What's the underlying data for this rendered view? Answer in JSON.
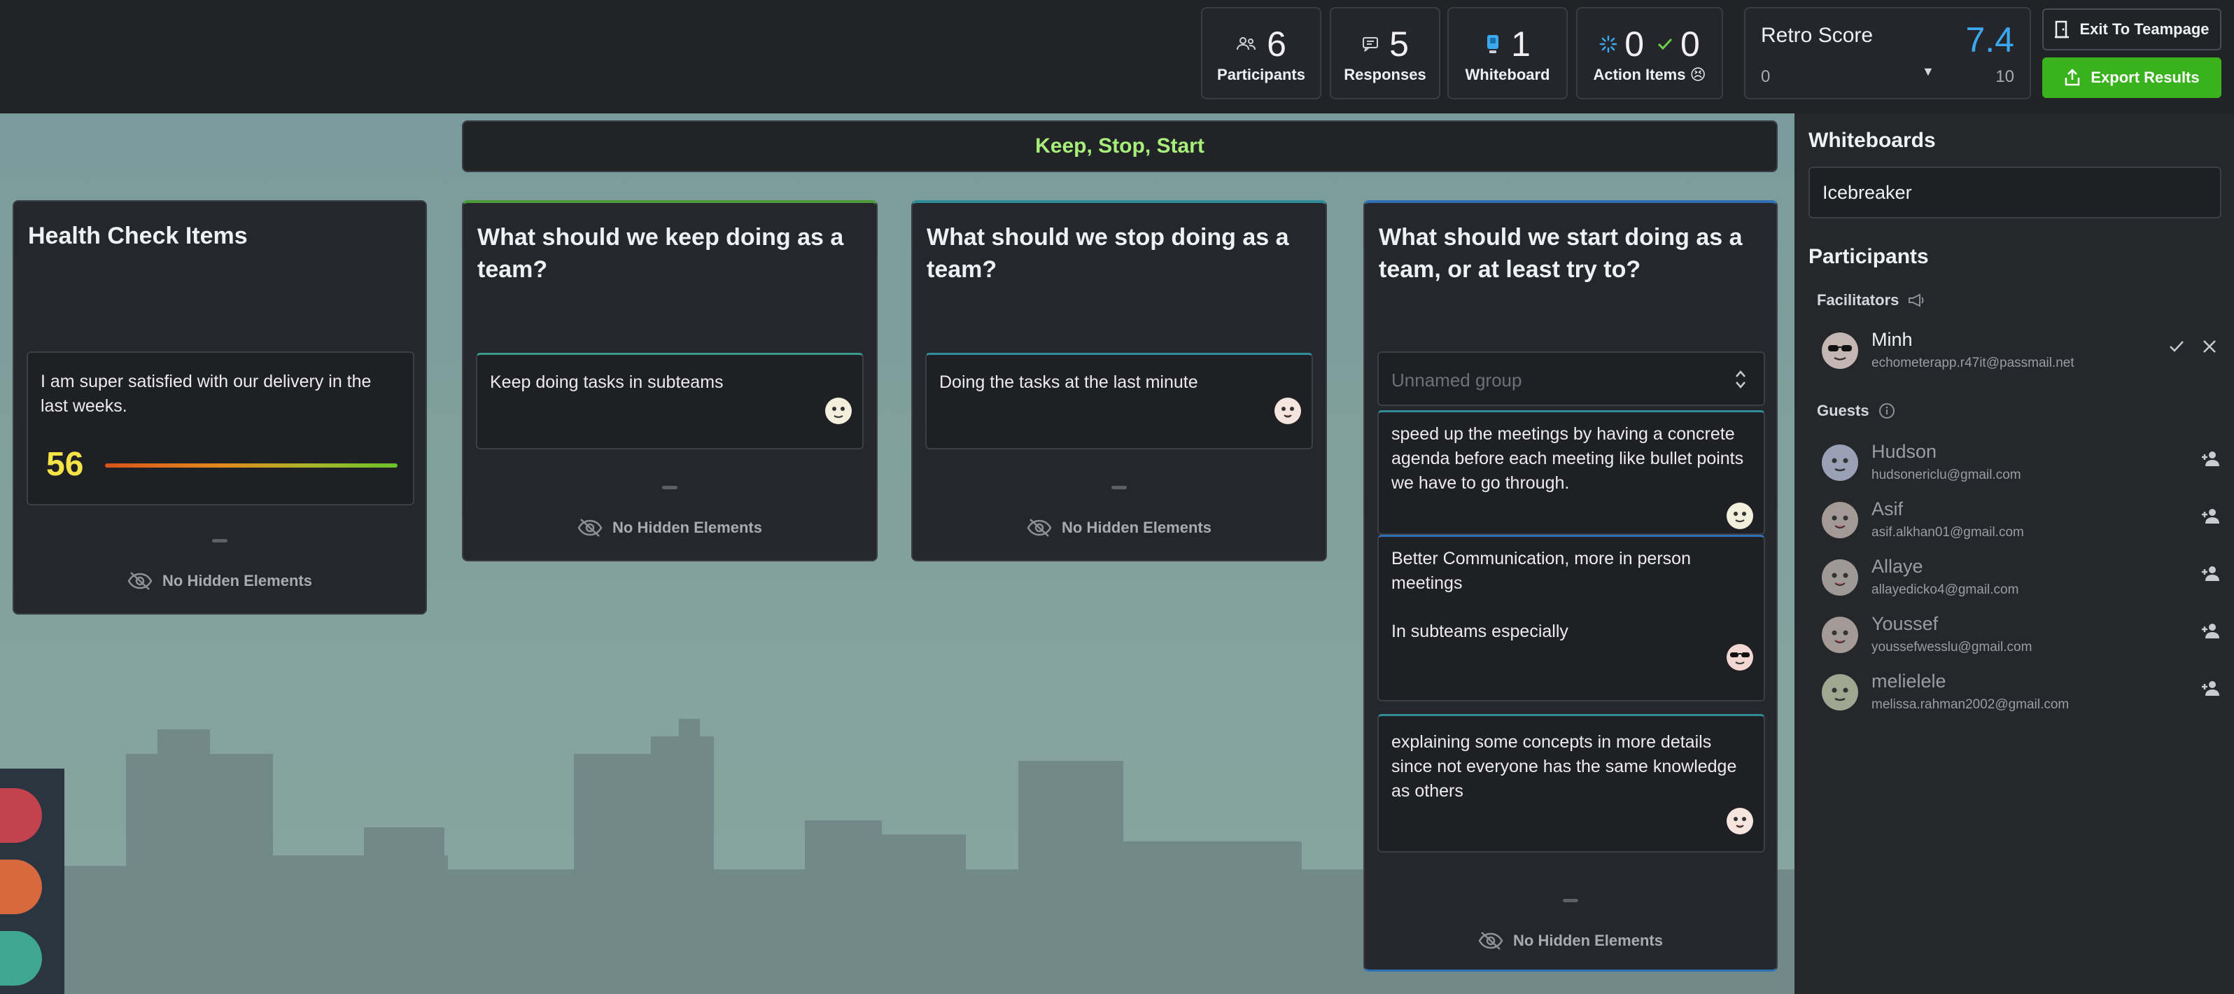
{
  "topbar": {
    "stats": [
      {
        "value": "6",
        "label": "Participants",
        "icon": "participants-icon"
      },
      {
        "value": "5",
        "label": "Responses",
        "icon": "responses-icon"
      },
      {
        "value": "1",
        "label": "Whiteboard",
        "icon": "whiteboard-icon"
      }
    ],
    "action_items": {
      "pending": "0",
      "done": "0",
      "label": "Action Items",
      "emoji": "😣"
    },
    "retro_score": {
      "title": "Retro Score",
      "value": "7.4",
      "min": "0",
      "max": "10"
    },
    "exit_label": "Exit To Teampage",
    "export_label": "Export Results"
  },
  "board": {
    "title": "Keep, Stop, Start"
  },
  "columns": {
    "health": {
      "title": "Health Check Items",
      "card_text": "I am super satisfied with our delivery in the last weeks.",
      "score": "56",
      "hidden_label": "No Hidden Elements"
    },
    "keep": {
      "title": "What should we keep doing as a team?",
      "card_text": "Keep doing tasks in subteams",
      "hidden_label": "No Hidden Elements"
    },
    "stop": {
      "title": "What should we stop doing as a team?",
      "card_text": "Doing the tasks at the last minute",
      "hidden_label": "No Hidden Elements"
    },
    "start": {
      "title": "What should we start doing as a team, or at least try to?",
      "group_placeholder": "Unnamed group",
      "cards": [
        "speed up the meetings by having a concrete agenda before each meeting like bullet points we have to go through.",
        "Better Communication, more in person meetings",
        "In subteams especially",
        "explaining some concepts in more details since not everyone has the same knowledge as others"
      ],
      "hidden_label": "No Hidden Elements"
    }
  },
  "panel": {
    "whiteboards_heading": "Whiteboards",
    "whiteboard_name": "Icebreaker",
    "participants_heading": "Participants",
    "facilitators_label": "Facilitators",
    "guests_label": "Guests",
    "facilitators": [
      {
        "name": "Minh",
        "email": "echometerapp.r47it@passmail.net"
      }
    ],
    "guests": [
      {
        "name": "Hudson",
        "email": "hudsonericlu@gmail.com"
      },
      {
        "name": "Asif",
        "email": "asif.alkhan01@gmail.com"
      },
      {
        "name": "Allaye",
        "email": "allayedicko4@gmail.com"
      },
      {
        "name": "Youssef",
        "email": "youssefwesslu@gmail.com"
      },
      {
        "name": "melielele",
        "email": "melissa.rahman2002@gmail.com"
      }
    ]
  },
  "colors": {
    "accent_green": "#3ab21e",
    "title_green": "#a6ef7a",
    "score_blue": "#3aa9f0",
    "health_yellow": "#f5e348"
  }
}
